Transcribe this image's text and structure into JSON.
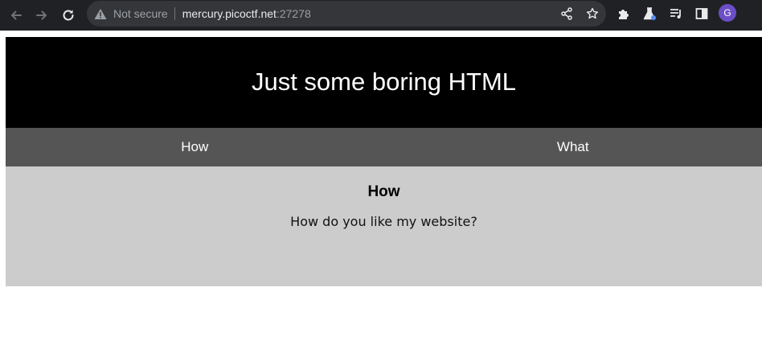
{
  "browser": {
    "security_label": "Not secure",
    "url_host": "mercury.picoctf.net",
    "url_port": ":27278",
    "profile_initial": "G",
    "accent_color": "#6b4fc6"
  },
  "page": {
    "header_title": "Just some boring HTML",
    "tabs": [
      {
        "label": "How"
      },
      {
        "label": "What"
      }
    ],
    "panel": {
      "heading": "How",
      "text": "How do you like my website?"
    },
    "colors": {
      "header_bg": "#000000",
      "tabbar_bg": "#555555",
      "panel_bg": "#cccccc"
    }
  }
}
